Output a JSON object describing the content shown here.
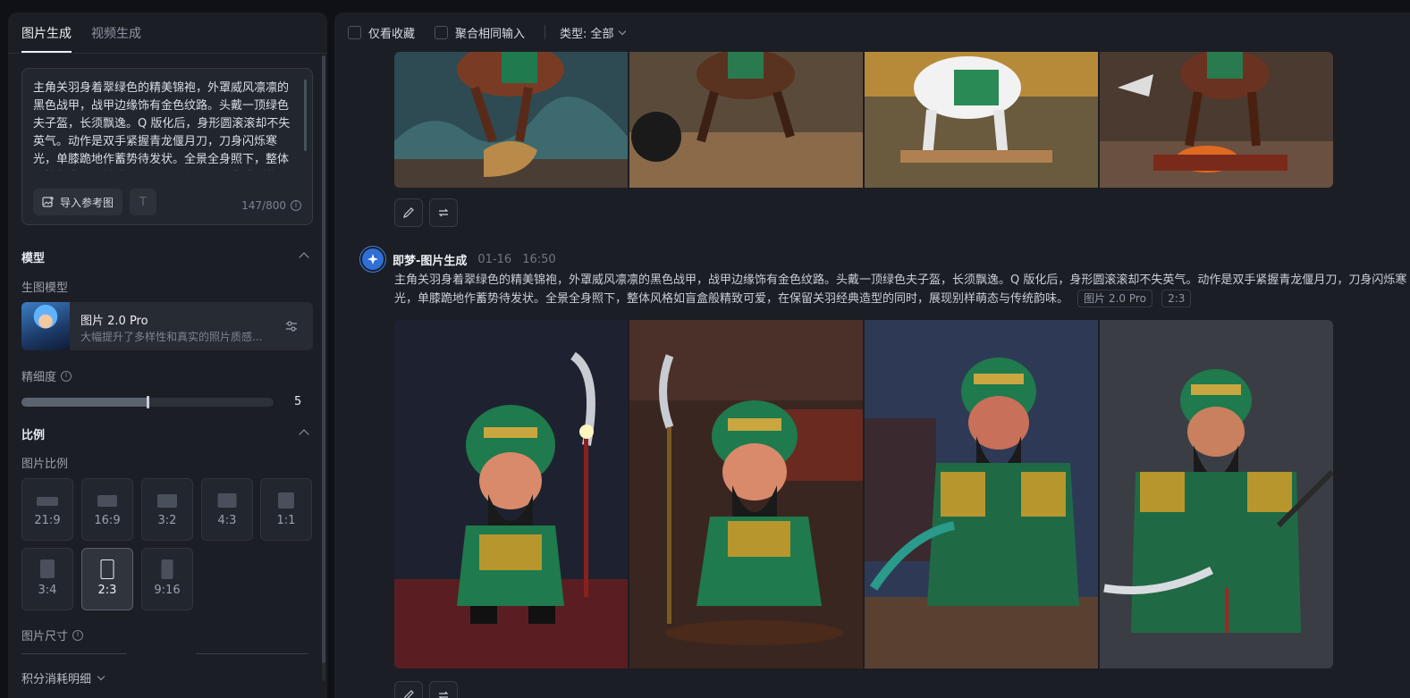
{
  "left_panel": {
    "tabs": [
      {
        "label": "图片生成",
        "active": true
      },
      {
        "label": "视频生成",
        "active": false
      }
    ],
    "prompt": {
      "text": "主角关羽身着翠绿色的精美锦袍，外罩威风凛凛的黑色战甲，战甲边缘饰有金色纹路。头戴一顶绿色夫子盔，长须飘逸。Q 版化后，身形圆滚滚却不失英气。动作是双手紧握青龙偃月刀，刀身闪烁寒光，单膝跪地作蓄势待发状。全景全身照下，整体风格如盲盒般精致可爱，在保留关羽经典造型的同时，展现别样萌态与传统韵味。",
      "import_button": "导入参考图",
      "counter": "147/800"
    },
    "model_section": {
      "title": "模型",
      "sub_label": "生图模型",
      "model_name": "图片 2.0 Pro",
      "model_desc": "大幅提升了多样性和真实的照片质感..."
    },
    "precision": {
      "label": "精细度",
      "value": 5,
      "fraction": 0.5
    },
    "ratio_section": {
      "title": "比例",
      "sub_label": "图片比例",
      "ratios": [
        {
          "label": "21:9",
          "active": false
        },
        {
          "label": "16:9",
          "active": false
        },
        {
          "label": "3:2",
          "active": false
        },
        {
          "label": "4:3",
          "active": false
        },
        {
          "label": "1:1",
          "active": false
        },
        {
          "label": "3:4",
          "active": false
        },
        {
          "label": "2:3",
          "active": true
        },
        {
          "label": "9:16",
          "active": false
        }
      ]
    },
    "size_label": "图片尺寸",
    "cost_label": "积分消耗明细"
  },
  "toolbar": {
    "favorites_only": "仅看收藏",
    "merge_same_input": "聚合相同输入",
    "type_filter": "类型: 全部"
  },
  "generation": {
    "bot_name": "即梦-图片生成",
    "date": "01-16",
    "time": "16:50",
    "prompt": "主角关羽身着翠绿色的精美锦袍，外罩威风凛凛的黑色战甲，战甲边缘饰有金色纹路。头戴一顶绿色夫子盔，长须飘逸。Q 版化后，身形圆滚滚却不失英气。动作是双手紧握青龙偃月刀，刀身闪烁寒光，单膝跪地作蓄势待发状。全景全身照下，整体风格如盲盒般精致可爱，在保留关羽经典造型的同时，展现别样萌态与传统韵味。",
    "model_chip": "图片 2.0 Pro",
    "ratio_chip": "2:3"
  },
  "icons": {
    "edit": "edit-icon",
    "regenerate": "regenerate-icon",
    "import": "image-add-icon",
    "settings": "sliders-icon"
  }
}
